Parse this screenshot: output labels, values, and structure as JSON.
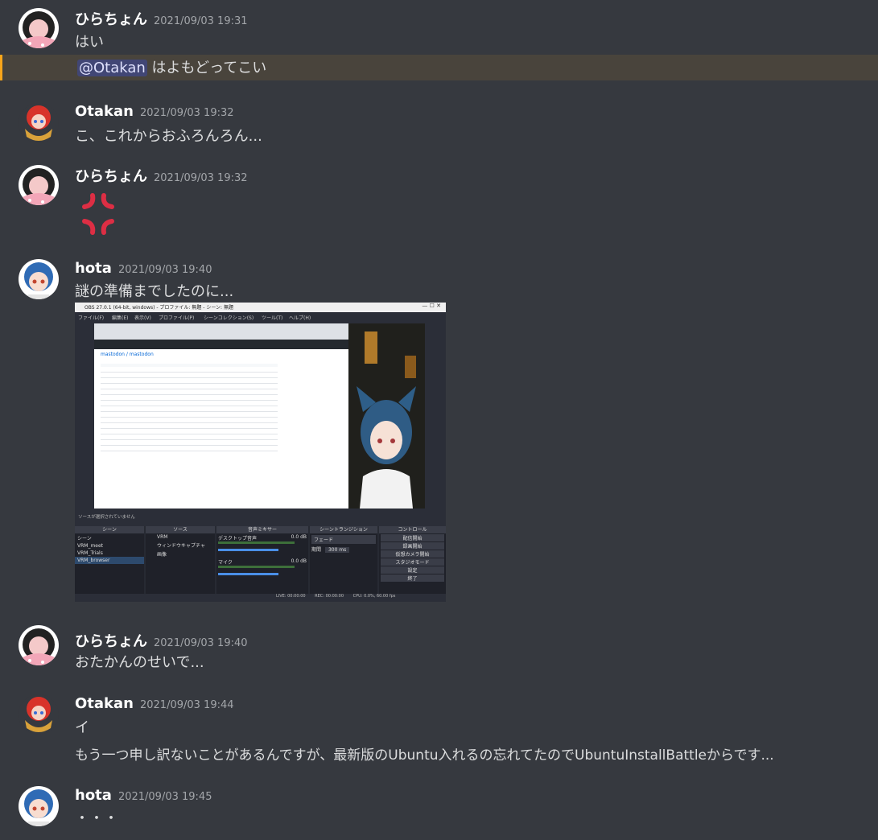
{
  "messages": [
    {
      "user": "ひらちょん",
      "time": "2021/09/03 19:31",
      "lines": [
        "はい"
      ],
      "mention": {
        "tag": "@Otakan",
        "text": " はよもどってこい"
      }
    },
    {
      "user": "Otakan",
      "time": "2021/09/03 19:32",
      "lines": [
        "こ、これからおふろんろん..."
      ]
    },
    {
      "user": "ひらちょん",
      "time": "2021/09/03 19:32",
      "emoji": "anger-symbol"
    },
    {
      "user": "hota",
      "time": "2021/09/03 19:40",
      "lines": [
        "謎の準備までしたのに..."
      ]
    },
    {
      "user": "ひらちょん",
      "time": "2021/09/03 19:40",
      "lines": [
        "おたかんのせいで..."
      ]
    },
    {
      "user": "Otakan",
      "time": "2021/09/03 19:44",
      "lines": [
        "イ",
        "もう一つ申し訳ないことがあるんですが、最新版のUbuntu入れるの忘れてたのでUbuntuInstallBattleからです..."
      ]
    },
    {
      "user": "hota",
      "time": "2021/09/03 19:45",
      "lines": [
        "・・・"
      ]
    }
  ],
  "obs": {
    "title": "OBS 27.0.1 (64-bit, windows) - プロファイル: 無題 - シーン: 無題",
    "menu": [
      "ファイル(F)",
      "編集(E)",
      "表示(V)",
      "プロファイル(P)",
      "シーンコレクション(S)",
      "ツール(T)",
      "ヘルプ(H)"
    ],
    "status_bar": "ソースが選択されていません",
    "panels": {
      "scenes": "シーン",
      "sources": "ソース",
      "mixer": "音声ミキサー",
      "transitions": "シーントランジション",
      "controls": "コントロール"
    },
    "scenes": [
      "シーン",
      "VRM_meet",
      "VRM_Trials",
      "VRM_browser"
    ],
    "sources": [
      "VRM",
      "ウィンドウキャプチャ",
      "画像"
    ],
    "mixer": [
      {
        "name": "デスクトップ音声",
        "db": "0.0 dB"
      },
      {
        "name": "マイク",
        "db": "0.0 dB"
      }
    ],
    "transition": {
      "type": "フェード",
      "duration_label": "期間",
      "duration": "300 ms"
    },
    "control_buttons": [
      "配信開始",
      "録画開始",
      "仮想カメラ開始",
      "スタジオモード",
      "設定",
      "終了"
    ],
    "footer": {
      "live": "LIVE: 00:00:00",
      "rec": "REC: 00:00:00",
      "cpu": "CPU: 0.0%, 60.00 fps"
    },
    "repo": "mastodon / mastodon"
  },
  "colors": {
    "background": "#36393f",
    "mention_bg": "#49443c",
    "mention_bar": "#faa61a",
    "anger": "#dd2e44"
  }
}
